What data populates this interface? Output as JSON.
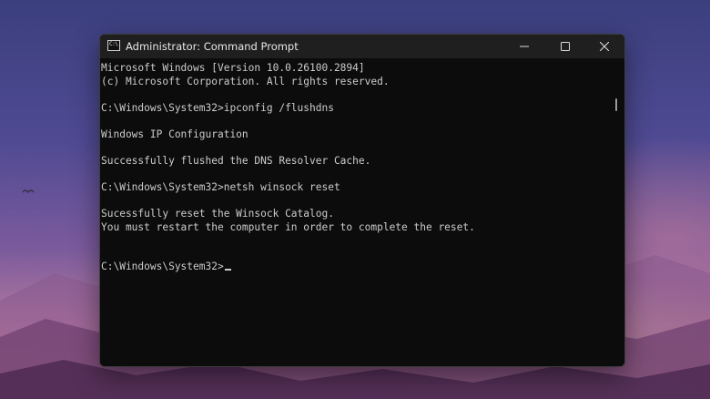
{
  "window": {
    "title": "Administrator: Command Prompt",
    "icon_name": "command-prompt-icon",
    "icon_text": "C:\\"
  },
  "controls": {
    "minimize_icon": "minimize-icon",
    "maximize_icon": "maximize-icon",
    "close_icon": "close-icon"
  },
  "console": {
    "lines": [
      "Microsoft Windows [Version 10.0.26100.2894]",
      "(c) Microsoft Corporation. All rights reserved.",
      "",
      "C:\\Windows\\System32>ipconfig /flushdns",
      "",
      "Windows IP Configuration",
      "",
      "Successfully flushed the DNS Resolver Cache.",
      "",
      "C:\\Windows\\System32>netsh winsock reset",
      "",
      "Sucessfully reset the Winsock Catalog.",
      "You must restart the computer in order to complete the reset.",
      "",
      "",
      "C:\\Windows\\System32>"
    ]
  },
  "colors": {
    "terminal_bg": "#0c0c0c",
    "terminal_text": "#cccccc",
    "titlebar_bg": "#1f1f1f"
  }
}
